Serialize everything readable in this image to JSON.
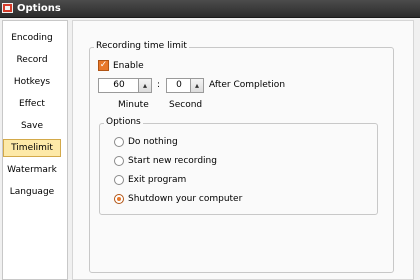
{
  "window": {
    "title": "Options"
  },
  "sidebar": {
    "items": [
      {
        "label": "Encoding"
      },
      {
        "label": "Record"
      },
      {
        "label": "Hotkeys"
      },
      {
        "label": "Effect"
      },
      {
        "label": "Save"
      },
      {
        "label": "Timelimit",
        "selected": true
      },
      {
        "label": "Watermark"
      },
      {
        "label": "Language"
      }
    ]
  },
  "timelimit": {
    "group_title": "Recording time limit",
    "enable": {
      "label": "Enable",
      "checked": true
    },
    "minute": {
      "value": "60",
      "label": "Minute"
    },
    "separator": ":",
    "second": {
      "value": "0",
      "label": "Second"
    },
    "after_label": "After Completion",
    "options": {
      "group_title": "Options",
      "choices": [
        {
          "label": "Do nothing",
          "selected": false
        },
        {
          "label": "Start new recording",
          "selected": false
        },
        {
          "label": "Exit program",
          "selected": false
        },
        {
          "label": "Shutdown your computer",
          "selected": true
        }
      ]
    }
  },
  "colors": {
    "accent": "#e8782a",
    "selection_bg": "#fde9a8",
    "titlebar": "#3a3a3a"
  },
  "icons": {
    "spin_button": "spin-arrows-icon",
    "app": "app-icon"
  }
}
